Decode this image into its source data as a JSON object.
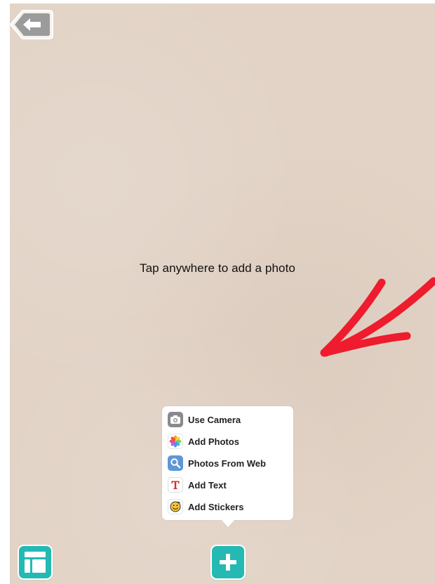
{
  "canvas": {
    "hint": "Tap anywhere to add a photo",
    "background_color": "#e2d3c6"
  },
  "toolbar": {
    "back_icon": "back-arrow-icon",
    "layout_icon": "layout-icon",
    "add_icon": "plus-icon",
    "accent_color": "#24b9b3"
  },
  "annotation": {
    "arrow_color": "#ee1c2e"
  },
  "add_menu": {
    "items": [
      {
        "label": "Use Camera",
        "icon": "camera-icon"
      },
      {
        "label": "Add Photos",
        "icon": "photos-icon"
      },
      {
        "label": "Photos From Web",
        "icon": "search-icon"
      },
      {
        "label": "Add Text",
        "icon": "text-icon"
      },
      {
        "label": "Add Stickers",
        "icon": "sticker-icon"
      }
    ]
  }
}
